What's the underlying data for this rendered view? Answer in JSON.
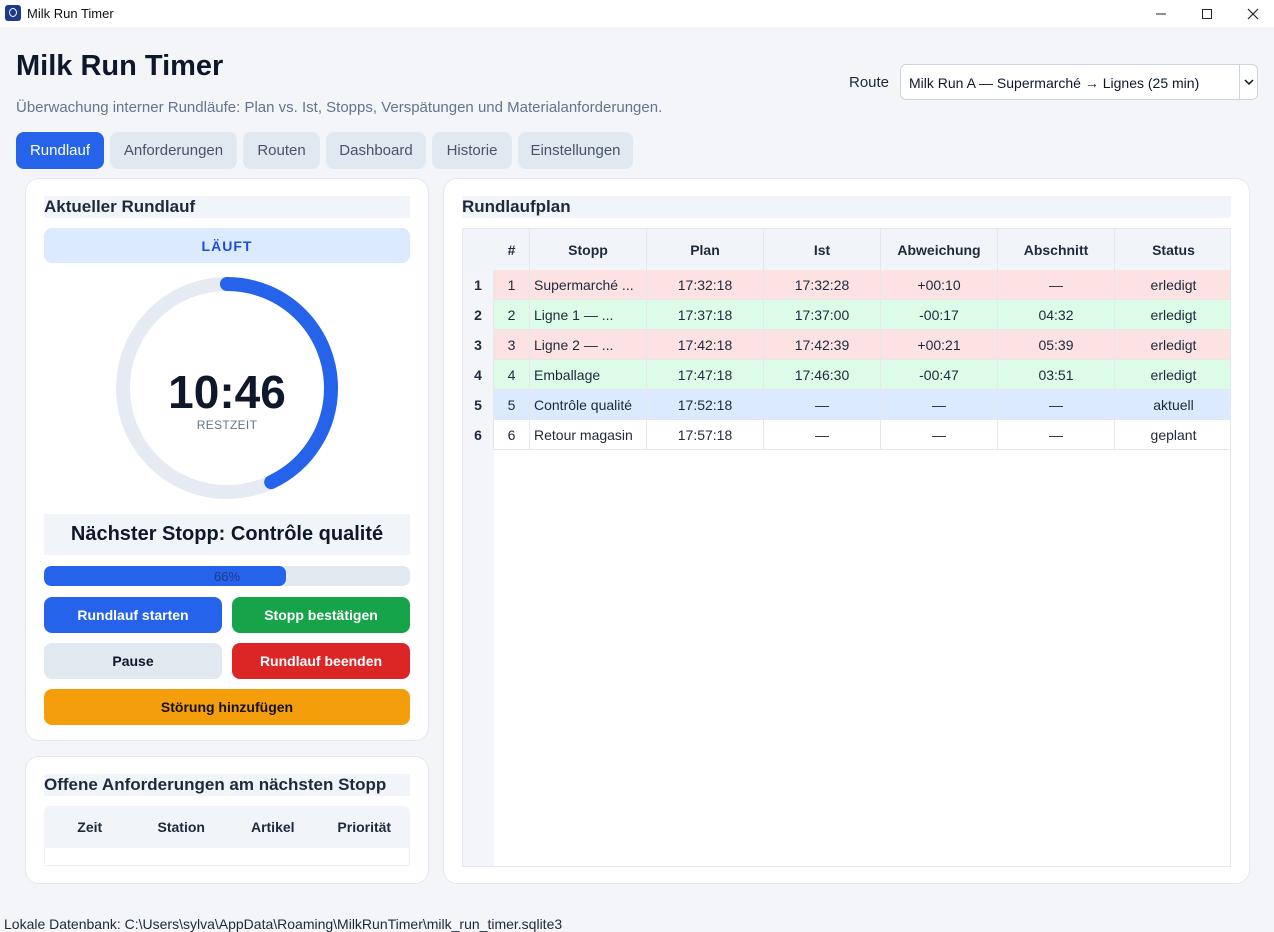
{
  "window": {
    "title": "Milk Run Timer"
  },
  "header": {
    "title": "Milk Run Timer",
    "subtitle": "Überwachung interner Rundläufe: Plan vs. Ist, Stopps, Verspätungen und Materialanforderungen.",
    "route_label": "Route",
    "route_value": "Milk Run A — Supermarché → Lignes (25 min)"
  },
  "tabs": [
    {
      "label": "Rundlauf",
      "active": true
    },
    {
      "label": "Anforderungen",
      "active": false
    },
    {
      "label": "Routen",
      "active": false
    },
    {
      "label": "Dashboard",
      "active": false
    },
    {
      "label": "Historie",
      "active": false
    },
    {
      "label": "Einstellungen",
      "active": false
    }
  ],
  "current": {
    "title": "Aktueller Rundlauf",
    "status": "LÄUFT",
    "remaining_time": "10:46",
    "remaining_label": "RESTZEIT",
    "ring_fraction": 0.43,
    "next_stop": "Nächster Stopp: Contrôle qualité",
    "progress_percent": 66,
    "progress_text": "66%",
    "buttons": {
      "start": "Rundlauf starten",
      "confirm": "Stopp bestätigen",
      "pause": "Pause",
      "end": "Rundlauf beenden",
      "disturbance": "Störung hinzufügen"
    },
    "colors": {
      "accent": "#2563eb",
      "green": "#16a34a",
      "red": "#dc2626",
      "orange": "#f59e0b"
    }
  },
  "requests": {
    "title": "Offene Anforderungen am nächsten Stopp",
    "columns": [
      "Zeit",
      "Station",
      "Artikel",
      "Priorität"
    ]
  },
  "plan": {
    "title": "Rundlaufplan",
    "columns": [
      "#",
      "Stopp",
      "Plan",
      "Ist",
      "Abweichung",
      "Abschnitt",
      "Status"
    ],
    "rows": [
      {
        "rowhead": "1",
        "cells": [
          "1",
          "Supermarché ...",
          "17:32:18",
          "17:32:28",
          "+00:10",
          "—",
          "erledigt"
        ],
        "tone": "red"
      },
      {
        "rowhead": "2",
        "cells": [
          "2",
          "Ligne 1 — ...",
          "17:37:18",
          "17:37:00",
          "-00:17",
          "04:32",
          "erledigt"
        ],
        "tone": "green"
      },
      {
        "rowhead": "3",
        "cells": [
          "3",
          "Ligne 2 — ...",
          "17:42:18",
          "17:42:39",
          "+00:21",
          "05:39",
          "erledigt"
        ],
        "tone": "red"
      },
      {
        "rowhead": "4",
        "cells": [
          "4",
          "Emballage",
          "17:47:18",
          "17:46:30",
          "-00:47",
          "03:51",
          "erledigt"
        ],
        "tone": "green"
      },
      {
        "rowhead": "5",
        "cells": [
          "5",
          "Contrôle qualité",
          "17:52:18",
          "—",
          "—",
          "—",
          "aktuell"
        ],
        "tone": "blue"
      },
      {
        "rowhead": "6",
        "cells": [
          "6",
          "Retour magasin",
          "17:57:18",
          "—",
          "—",
          "—",
          "geplant"
        ],
        "tone": "white"
      }
    ],
    "tone_colors": {
      "red": "#fde2e4",
      "green": "#dcfce7",
      "blue": "#dbeafe",
      "white": "#ffffff"
    }
  },
  "footer": {
    "text": "Lokale Datenbank: C:\\Users\\sylva\\AppData\\Roaming\\MilkRunTimer\\milk_run_timer.sqlite3"
  }
}
